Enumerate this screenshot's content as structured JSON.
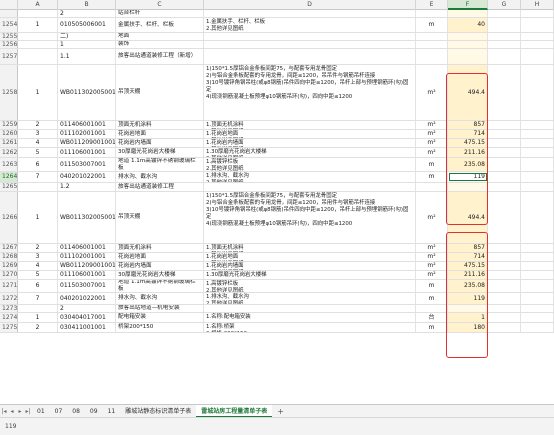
{
  "columns": [
    "A",
    "B",
    "C",
    "D",
    "E",
    "F",
    "G",
    "H"
  ],
  "active_column": "F",
  "rows": [
    {
      "num": "",
      "a": "",
      "b": "2",
      "c": "站台栏杆",
      "d": "",
      "e": "",
      "f": ""
    },
    {
      "num": "1254",
      "a": "1",
      "b": "010505006001",
      "c": "金属扶手、栏杆、栏板",
      "d": "1.金属扶手、栏杆、栏板\n2.其他详见图纸",
      "e": "m",
      "f": "40"
    },
    {
      "num": "1255",
      "a": "",
      "b": "二)",
      "c": "地面",
      "d": "",
      "e": "",
      "f": ""
    },
    {
      "num": "1256",
      "a": "",
      "b": "1",
      "c": "装饰",
      "d": "",
      "e": "",
      "f": ""
    },
    {
      "num": "1257",
      "a": "",
      "b": "1.1",
      "c": "旅客出站通道装修工程（新增）",
      "d": "",
      "e": "",
      "f": ""
    },
    {
      "num": "1258",
      "a": "1",
      "b": "WB011302005001",
      "c": "吊顶天棚",
      "d": "1)150*1.5厚铝合金条板间距75，与配套专用龙骨固定\n2)与铝合金条板配套的专用龙骨，间距≤1200，吊吊件与钢筋吊杆连接\n3)10号镀锌角钢吊柱(或φ8钢筋)吊件四向中距≤1200，吊杆上部与预埋钢筋环(勾)固定\n4)现浇钢筋混凝土板预埋φ10钢筋吊环(勾)，四向中距≤1200",
      "e": "m²",
      "f": "494.4"
    },
    {
      "num": "1259",
      "a": "2",
      "b": "011406001001",
      "c": "顶面无机涂料",
      "d": "1.顶面无机涂料\n2.其他详见图纸",
      "e": "m²",
      "f": "857"
    },
    {
      "num": "1260",
      "a": "3",
      "b": "011102001001",
      "c": "花岗岩地面",
      "d": "1.花岗岩地面\n2.其他详见图纸",
      "e": "m²",
      "f": "714"
    },
    {
      "num": "1261",
      "a": "4",
      "b": "WB011209001001",
      "c": "花岗岩内墙面",
      "d": "1.花岗岩内墙面\n2.其他详见图纸",
      "e": "m²",
      "f": "475.15"
    },
    {
      "num": "1262",
      "a": "5",
      "b": "011106001001",
      "c": "30厚磨光花岗岩大楼梯",
      "d": "1.30厚磨光花岗岩大楼梯\n2.其他详见图纸",
      "e": "m²",
      "f": "211.16"
    },
    {
      "num": "1263",
      "a": "6",
      "b": "011503007001",
      "c": "地道 1.1m高镀锌不锈钢玻璃栏板",
      "d": "1.高镀锌栏板\n2.其他详见图纸",
      "e": "m",
      "f": "235.08"
    },
    {
      "num": "1264",
      "a": "7",
      "b": "040201022001",
      "c": "排水沟、截水沟",
      "d": "1.排水沟、截水沟\n2.其他详见图纸",
      "e": "m",
      "f": "119"
    },
    {
      "num": "1265",
      "a": "",
      "b": "1.2",
      "c": "旅客出站通道装修工程",
      "d": "",
      "e": "",
      "f": ""
    },
    {
      "num": "1266",
      "a": "1",
      "b": "WB011302005001",
      "c": "吊顶天棚",
      "d": "1)150*1.5厚铝合金条板间距75，与配套专用龙骨固定\n2)与铝合金条板配套的专用龙骨，间距≤1200，吊用件与钢筋吊杆连接\n3)10号镀锌角钢吊柱(或φ8钢筋)吊件四向中距≤1200，吊杆上部与预埋钢筋环(勾)固定\n4)现浇钢筋混凝土板预埋φ10钢筋吊环(勾)，四向中距≤1200",
      "e": "m²",
      "f": "494.4"
    },
    {
      "num": "1267",
      "a": "2",
      "b": "011406001001",
      "c": "顶面无机涂料",
      "d": "1.顶面无机涂料\n2.其他详见图纸",
      "e": "m²",
      "f": "857"
    },
    {
      "num": "1268",
      "a": "3",
      "b": "011102001001",
      "c": "花岗岩地面",
      "d": "1.花岗岩地面\n2.其他详见图纸",
      "e": "m²",
      "f": "714"
    },
    {
      "num": "1269",
      "a": "4",
      "b": "WB011209001001",
      "c": "花岗岩内墙面",
      "d": "1.花岗岩内墙面\n2.其他详见图纸",
      "e": "m²",
      "f": "475.15"
    },
    {
      "num": "1270",
      "a": "5",
      "b": "011106001001",
      "c": "30厚磨光花岗岩大楼梯",
      "d": "1.30厚磨光花岗岩大楼梯",
      "e": "m²",
      "f": "211.16"
    },
    {
      "num": "1271",
      "a": "6",
      "b": "011503007001",
      "c": "地道 1.1m高镀锌不锈钢玻璃栏板",
      "d": "1.高镀锌栏板\n2.其他详见图纸",
      "e": "m",
      "f": "235.08"
    },
    {
      "num": "1272",
      "a": "7",
      "b": "040201022001",
      "c": "排水沟、截水沟",
      "d": "1.排水沟、截水沟\n2.其他详见图纸",
      "e": "m",
      "f": "119"
    },
    {
      "num": "1273",
      "a": "",
      "b": "2",
      "c": "旅客出站地道—机电安装",
      "d": "",
      "e": "",
      "f": ""
    },
    {
      "num": "1274",
      "a": "1",
      "b": "030404017001",
      "c": "配电箱安装",
      "d": "1.名称:配电箱安装",
      "e": "台",
      "f": "1"
    },
    {
      "num": "1275",
      "a": "2",
      "b": "030411001001",
      "c": "桥架200*150",
      "d": "1.名称:桥架\n2.规格:200*150",
      "e": "m",
      "f": "180"
    }
  ],
  "tabs": [
    "01",
    "07",
    "08",
    "09",
    "11",
    "雕城站静态标识清单子表",
    "雷城站房工程量清单子表"
  ],
  "active_tab": "雷城站房工程量清单子表",
  "add_tab_label": "+",
  "status": {
    "cell_name": "F1264",
    "cell_value": "119"
  }
}
